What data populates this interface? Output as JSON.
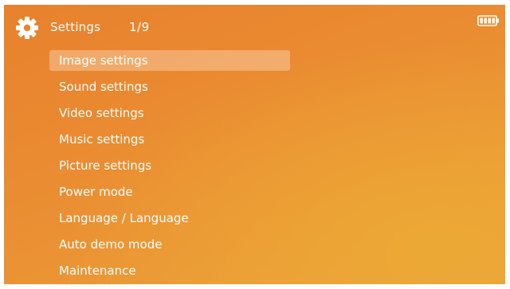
{
  "header": {
    "title": "Settings",
    "counter": "1/9",
    "icon": "gear-icon",
    "battery_icon": "battery-icon"
  },
  "menu": {
    "selected_index": 0,
    "items": [
      {
        "label": "Image settings"
      },
      {
        "label": "Sound settings"
      },
      {
        "label": "Video settings"
      },
      {
        "label": "Music settings"
      },
      {
        "label": "Picture settings"
      },
      {
        "label": "Power mode"
      },
      {
        "label": "Language / Language"
      },
      {
        "label": "Auto demo mode"
      },
      {
        "label": "Maintenance"
      }
    ]
  },
  "colors": {
    "background_start": "#e8812d",
    "background_end": "#eca43a",
    "text": "#ffffff",
    "selection": "#f6c08f"
  }
}
